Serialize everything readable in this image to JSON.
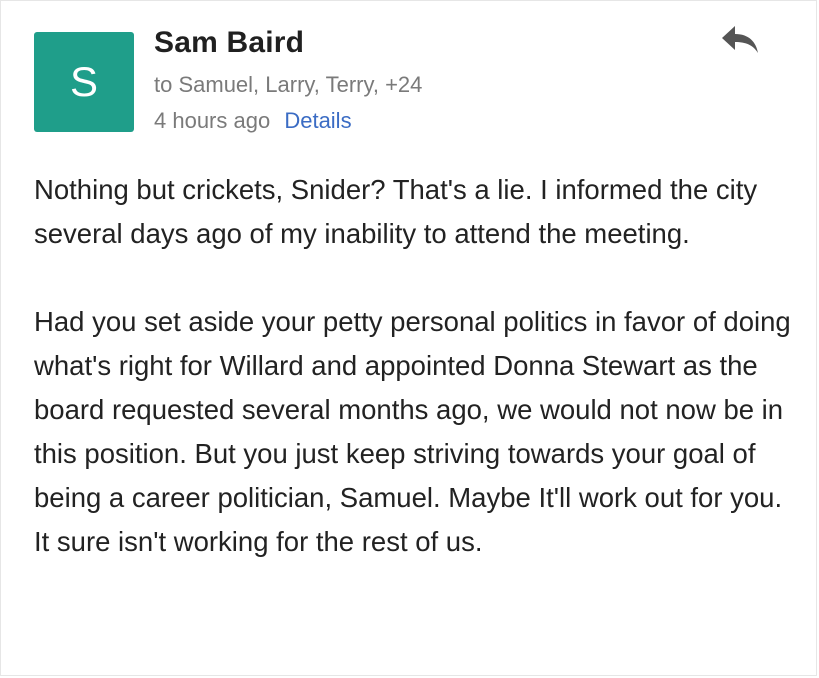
{
  "message": {
    "avatar_letter": "S",
    "sender": "Sam Baird",
    "recipients": "to Samuel, Larry, Terry, +24",
    "time": "4 hours ago",
    "details_label": "Details",
    "body": [
      "Nothing but crickets, Snider? That's a lie. I informed the city several days ago of my inability to attend the meeting.",
      "Had you set aside your petty personal politics in favor of doing what's right for Willard and appointed Donna Stewart as the board requested several months ago, we would not now be in this position. But you just keep striving towards your goal of being a career politician, Samuel. Maybe It'll work out for you. It sure isn't working for the rest of us."
    ]
  },
  "colors": {
    "avatar": "#1f9e8a",
    "link": "#3b6cc4",
    "secondary_text": "#7a7a7a"
  },
  "icons": {
    "reply": "reply-arrow-icon"
  }
}
